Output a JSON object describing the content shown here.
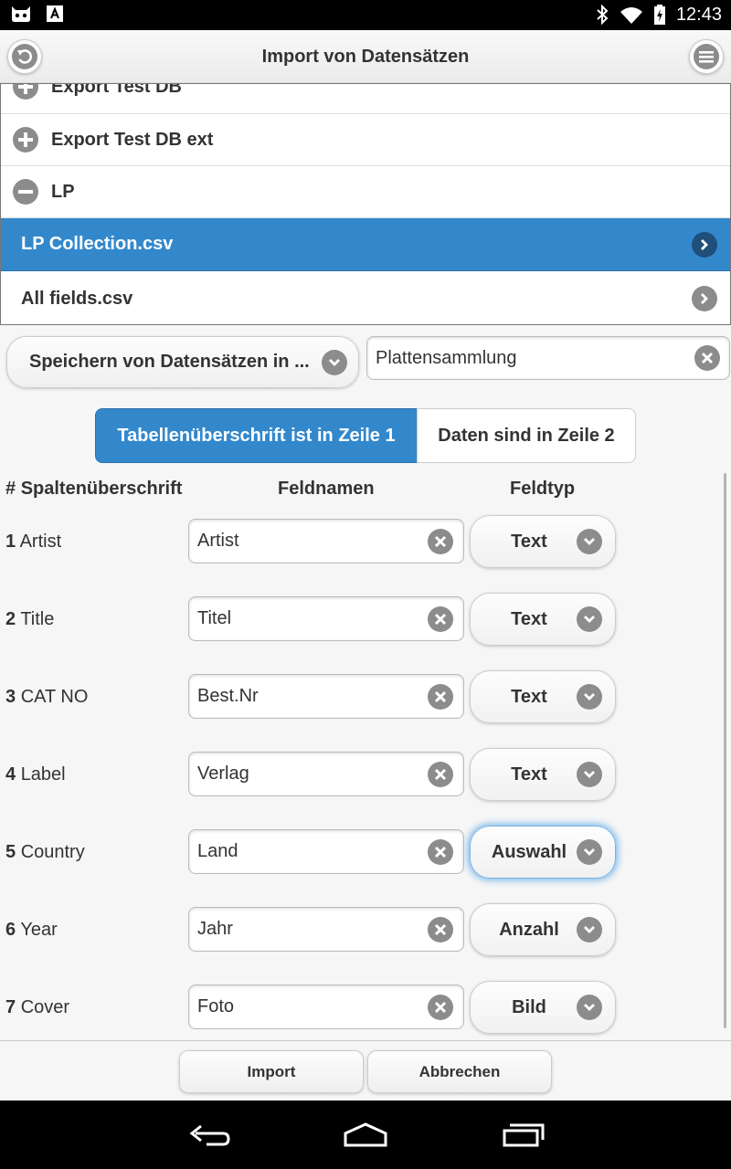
{
  "status_bar": {
    "time": "12:43"
  },
  "header": {
    "title": "Import von Datensätzen"
  },
  "file_list": {
    "items": [
      {
        "label": "Export Test DB",
        "type": "group",
        "state": "collapsed"
      },
      {
        "label": "Export Test DB ext",
        "type": "group",
        "state": "collapsed"
      },
      {
        "label": "LP",
        "type": "group",
        "state": "expanded"
      },
      {
        "label": "LP Collection.csv",
        "type": "file",
        "selected": true
      },
      {
        "label": "All fields.csv",
        "type": "file",
        "selected": false
      }
    ]
  },
  "target": {
    "select_label": "Speichern von Datensätzen in ...",
    "name_value": "Plattensammlung"
  },
  "header_options": {
    "active": "Tabellenüberschrift ist in Zeile 1",
    "inactive": "Daten sind in Zeile 2"
  },
  "columns": {
    "hash": "#",
    "col1": "Spaltenüberschrift",
    "col2": "Feldnamen",
    "col3": "Feldtyp"
  },
  "fields": [
    {
      "num": "1",
      "source": "Artist",
      "name": "Artist",
      "type": "Text"
    },
    {
      "num": "2",
      "source": "Title",
      "name": "Titel",
      "type": "Text"
    },
    {
      "num": "3",
      "source": "CAT NO",
      "name": "Best.Nr",
      "type": "Text"
    },
    {
      "num": "4",
      "source": "Label",
      "name": "Verlag",
      "type": "Text"
    },
    {
      "num": "5",
      "source": "Country",
      "name": "Land",
      "type": "Auswahl",
      "focused": true
    },
    {
      "num": "6",
      "source": "Year",
      "name": "Jahr",
      "type": "Anzahl"
    },
    {
      "num": "7",
      "source": "Cover",
      "name": "Foto",
      "type": "Bild"
    }
  ],
  "footer": {
    "import_label": "Import",
    "cancel_label": "Abbrechen"
  },
  "colors": {
    "accent": "#3388cc",
    "icon_gray": "#8c8c8c"
  }
}
